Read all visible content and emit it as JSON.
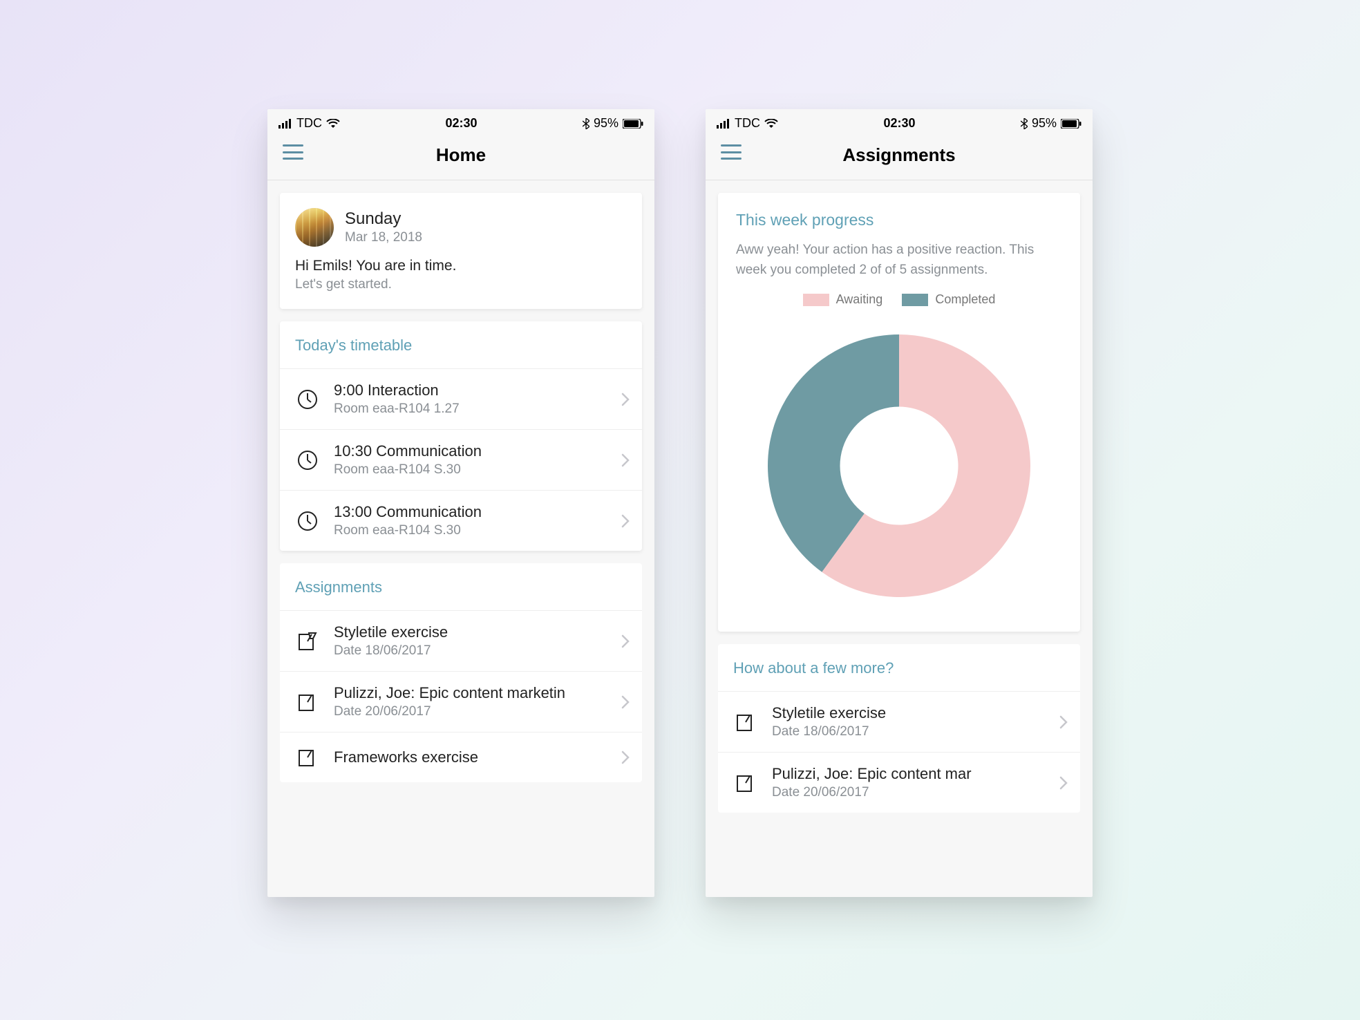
{
  "statusbar": {
    "carrier": "TDC",
    "time": "02:30",
    "battery_pct": "95%"
  },
  "home": {
    "nav_title": "Home",
    "greeting": {
      "day": "Sunday",
      "date": "Mar 18, 2018",
      "message": "Hi Emils! You are in time.",
      "sub": "Let's get started."
    },
    "timetable": {
      "heading": "Today's timetable",
      "items": [
        {
          "title": "9:00 Interaction",
          "sub": "Room eaa-R104 1.27"
        },
        {
          "title": "10:30 Communication",
          "sub": "Room eaa-R104 S.30"
        },
        {
          "title": "13:00 Communication",
          "sub": "Room eaa-R104 S.30"
        }
      ]
    },
    "assignments": {
      "heading": "Assignments",
      "items": [
        {
          "title": "Styletile exercise",
          "sub": "Date 18/06/2017"
        },
        {
          "title": "Pulizzi, Joe: Epic content marketin",
          "sub": "Date 20/06/2017"
        },
        {
          "title": "Frameworks exercise",
          "sub": ""
        }
      ]
    }
  },
  "assignments_screen": {
    "nav_title": "Assignments",
    "progress": {
      "heading": "This week progress",
      "text": "Aww yeah! Your action has a positive reaction. This week you completed 2 of of 5 assignments.",
      "legend": {
        "awaiting": "Awaiting",
        "completed": "Completed"
      }
    },
    "more": {
      "heading": "How about a few more?",
      "items": [
        {
          "title": "Styletile exercise",
          "sub": "Date 18/06/2017"
        },
        {
          "title": "Pulizzi, Joe: Epic content mar",
          "sub": "Date 20/06/2017"
        }
      ]
    }
  },
  "colors": {
    "accent": "#5fa0b5",
    "pink": "#f5c9ca",
    "teal": "#6f9ba3"
  },
  "chart_data": {
    "type": "pie",
    "title": "This week progress",
    "series": [
      {
        "name": "Awaiting",
        "value": 3,
        "color": "#f5c9ca"
      },
      {
        "name": "Completed",
        "value": 2,
        "color": "#6f9ba3"
      }
    ],
    "total": 5,
    "donut_inner_ratio": 0.45
  }
}
